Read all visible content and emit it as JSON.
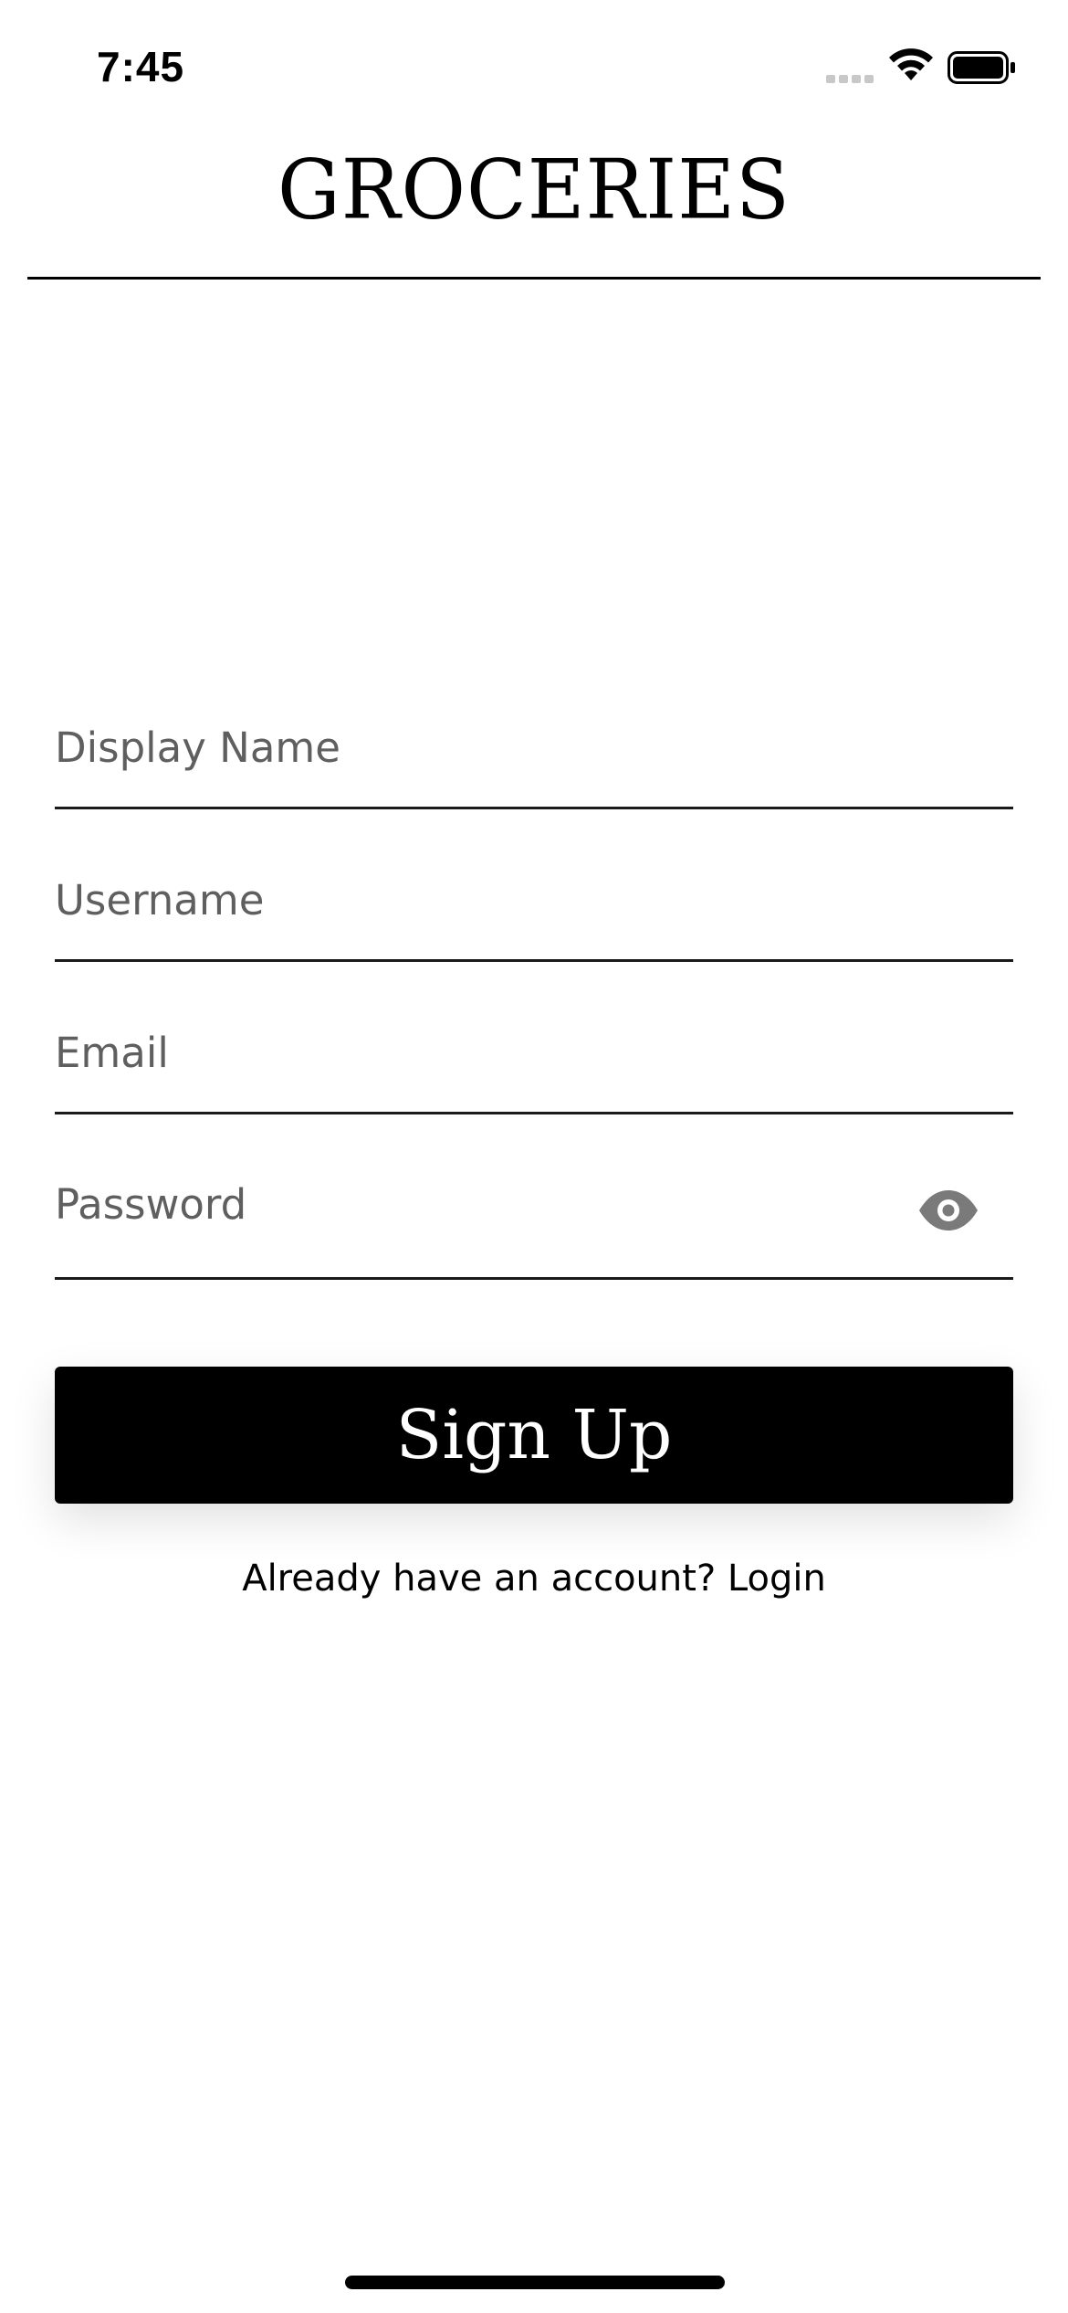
{
  "status_bar": {
    "time": "7:45",
    "icons": [
      "cellular-signal-icon",
      "wifi-icon",
      "battery-icon"
    ]
  },
  "app": {
    "title": "GROCERIES"
  },
  "form": {
    "display_name_placeholder": "Display Name",
    "username_placeholder": "Username",
    "email_placeholder": "Email",
    "password_placeholder": "Password",
    "password_toggle_icon": "eye-icon",
    "submit_label": "Sign Up"
  },
  "footer": {
    "login_prompt": "Already have an account? Login"
  },
  "colors": {
    "background": "#ffffff",
    "primary": "#000000",
    "placeholder": "#5f5f5f",
    "icon_gray": "#7a7a7a"
  }
}
